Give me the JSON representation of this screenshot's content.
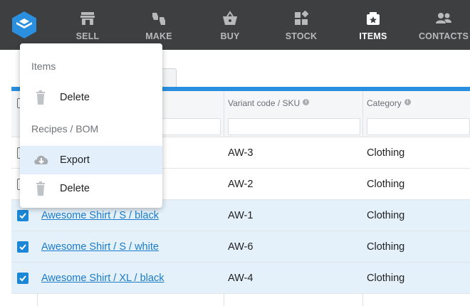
{
  "nav": {
    "items": [
      {
        "label": "SELL",
        "icon": "store-icon"
      },
      {
        "label": "MAKE",
        "icon": "thumbs-icon"
      },
      {
        "label": "BUY",
        "icon": "basket-icon"
      },
      {
        "label": "STOCK",
        "icon": "stock-icon"
      },
      {
        "label": "ITEMS",
        "icon": "items-icon",
        "active": true
      },
      {
        "label": "CONTACTS",
        "icon": "contacts-icon"
      }
    ]
  },
  "table": {
    "headers": {
      "sku": "Variant code / SKU",
      "category": "Category"
    },
    "rows": [
      {
        "name": "",
        "sku": "AW-3",
        "category": "Clothing",
        "checked": false
      },
      {
        "name": "",
        "sku": "AW-2",
        "category": "Clothing",
        "checked": false
      },
      {
        "name": "Awesome Shirt / S / black",
        "sku": "AW-1",
        "category": "Clothing",
        "checked": true
      },
      {
        "name": "Awesome Shirt / S / white",
        "sku": "AW-6",
        "category": "Clothing",
        "checked": true
      },
      {
        "name": "Awesome Shirt / XL / black",
        "sku": "AW-4",
        "category": "Clothing",
        "checked": true
      }
    ]
  },
  "menu": {
    "section_items": "Items",
    "items_delete": "Delete",
    "section_recipes": "Recipes / BOM",
    "recipes_export": "Export",
    "recipes_delete": "Delete"
  },
  "colors": {
    "nav_bg": "#3d3f41",
    "accent": "#2a8fde",
    "selected_row": "#e4f1fb",
    "link": "#1b7bc8"
  }
}
